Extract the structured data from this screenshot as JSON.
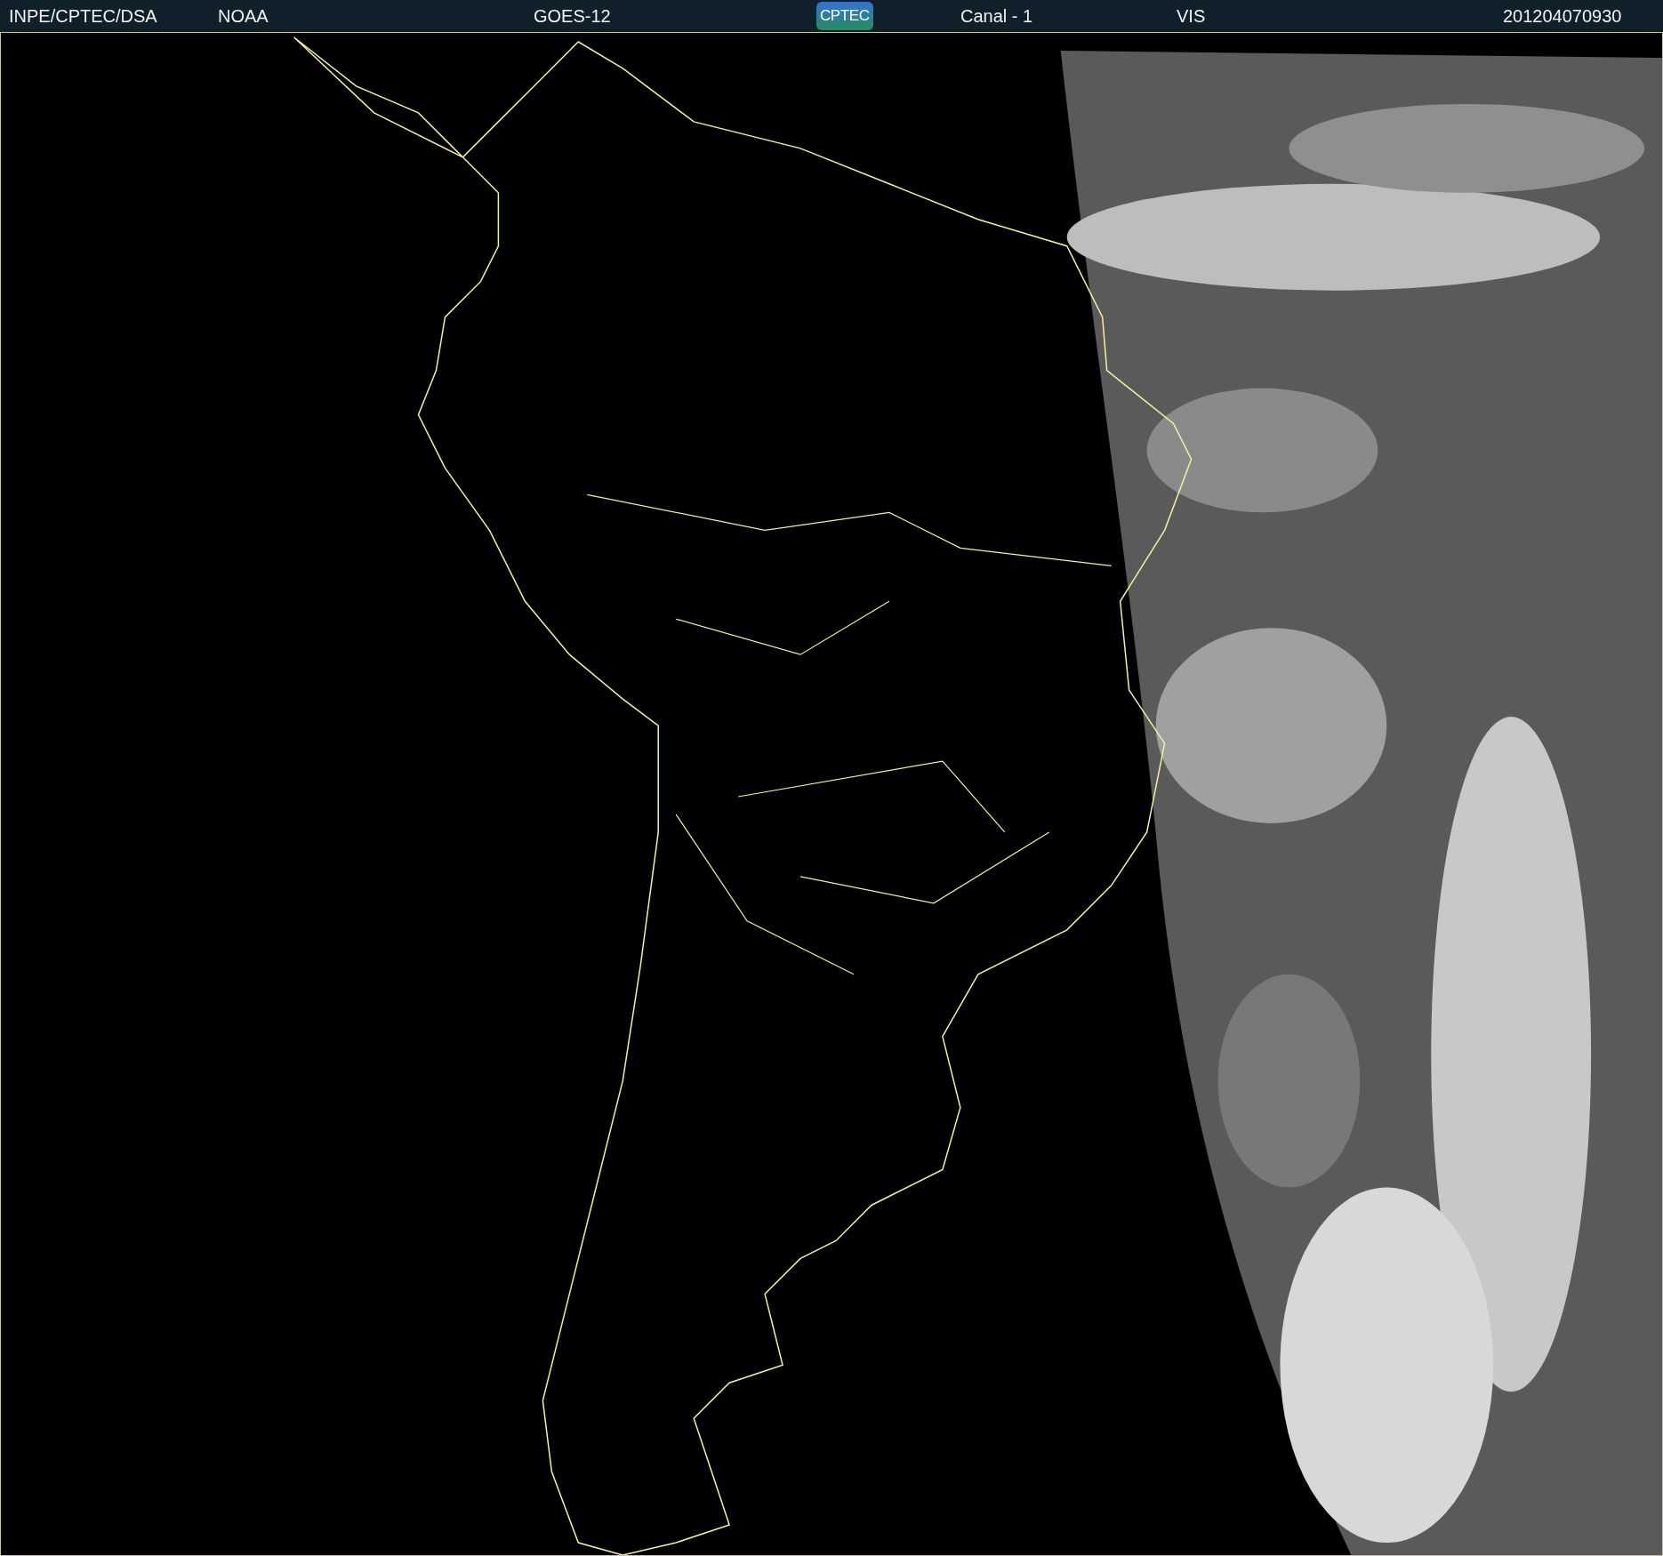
{
  "header": {
    "items": [
      {
        "kind": "text",
        "text": "INPE/CPTEC/DSA"
      },
      {
        "kind": "text",
        "text": "NOAA"
      },
      {
        "kind": "text",
        "text": "GOES-12"
      },
      {
        "kind": "logo",
        "text": "CPTEC"
      },
      {
        "kind": "text",
        "text": "Canal - 1"
      },
      {
        "kind": "text",
        "text": "VIS"
      },
      {
        "kind": "text",
        "text": "201204070930"
      }
    ]
  }
}
